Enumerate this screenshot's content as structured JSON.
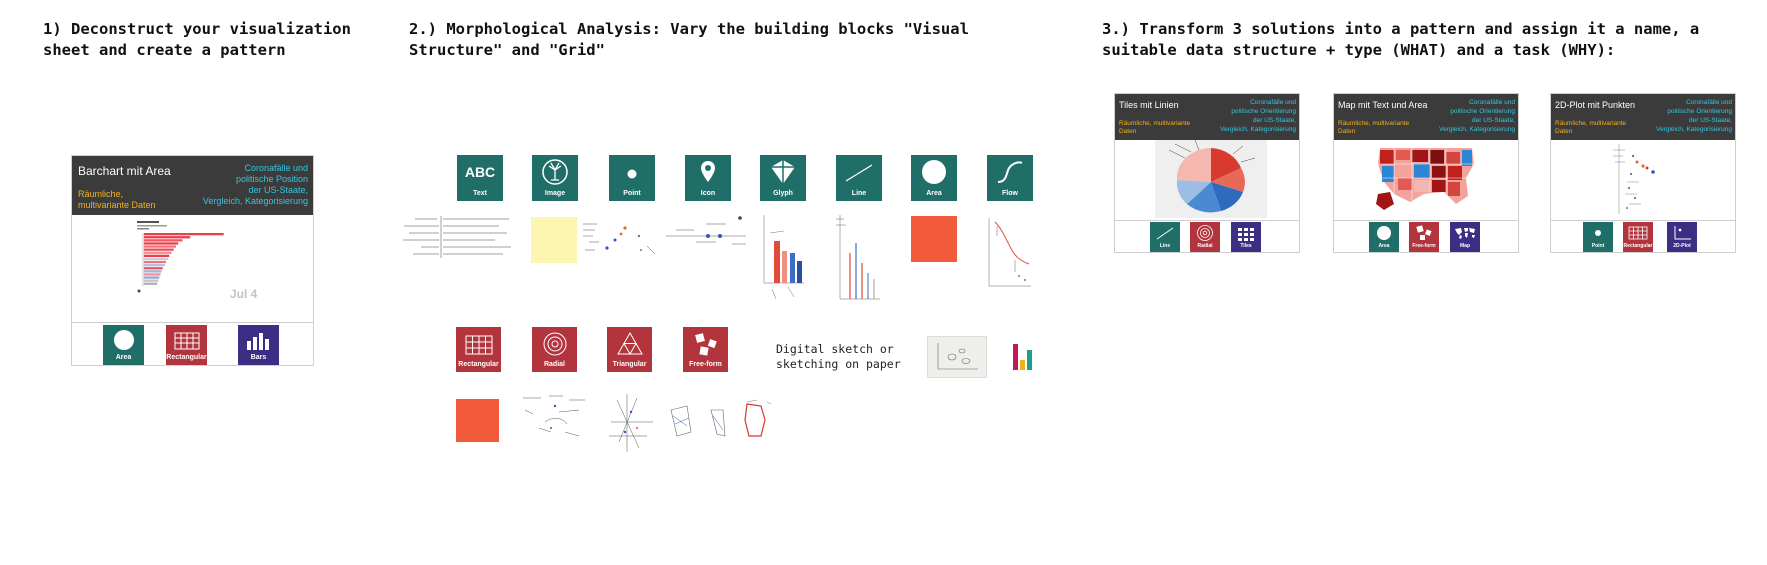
{
  "headings": {
    "step1": "1) Deconstruct your visualization\nsheet and create a pattern",
    "step2": "2.) Morphological Analysis: Vary the building blocks \"Visual\nStructure\" and \"Grid\"",
    "step3": "3.) Transform 3 solutions into a pattern and assign it a name, a\nsuitable data structure + type (WHAT) and a task (WHY):"
  },
  "pattern_card": {
    "title": "Barchart mit Area",
    "data": "Räumliche,\nmultivariante Daten",
    "task": "Coronafälle und\npolitische Position\nder US-Staate,\nVergleich, Kategorisierung",
    "date_label": "Jul 4",
    "tiles": [
      "Area",
      "Rectangular",
      "Bars"
    ]
  },
  "visual_structure_tiles": [
    "Text",
    "Image",
    "Point",
    "Icon",
    "Glyph",
    "Line",
    "Area",
    "Flow"
  ],
  "grid_tiles": [
    "Rectangular",
    "Radial",
    "Triangular",
    "Free-form"
  ],
  "sketch_note": "Digital sketch or\nsketching on paper",
  "solutions": [
    {
      "title": "Tiles mit Linien",
      "data": "Räumliche, multivariante\nDaten",
      "task": "Coronafälle und\npolitische Orientierung\nder US-Staate,\nVergleich, Kategorisierung",
      "tiles": [
        "Line",
        "Radial",
        "Tiles"
      ]
    },
    {
      "title": "Map mit Text und Area",
      "data": "Räumliche, multivariante\nDaten",
      "task": "Coronafälle und\npolitische Orientierung\nder US-Staate,\nVergleich, Kategorisierung",
      "tiles": [
        "Area",
        "Free-form",
        "Map"
      ]
    },
    {
      "title": "2D-Plot mit Punkten",
      "data": "Räumliche, multivariante\nDaten",
      "task": "Coronafälle und\npolitische Orientierung\nder US-Staate,\nVergleich, Kategorisierung",
      "tiles": [
        "Point",
        "Rectangular",
        "2D-Plot"
      ]
    }
  ],
  "colors": {
    "teal": "#1f6e68",
    "red": "#b2353d",
    "purple": "#3b2f85",
    "orange": "#f25a3c",
    "yellow_note": "#fdf6b0",
    "card_header": "#3b3b3b",
    "task_text": "#33c6e0",
    "data_text": "#f2b21c"
  }
}
